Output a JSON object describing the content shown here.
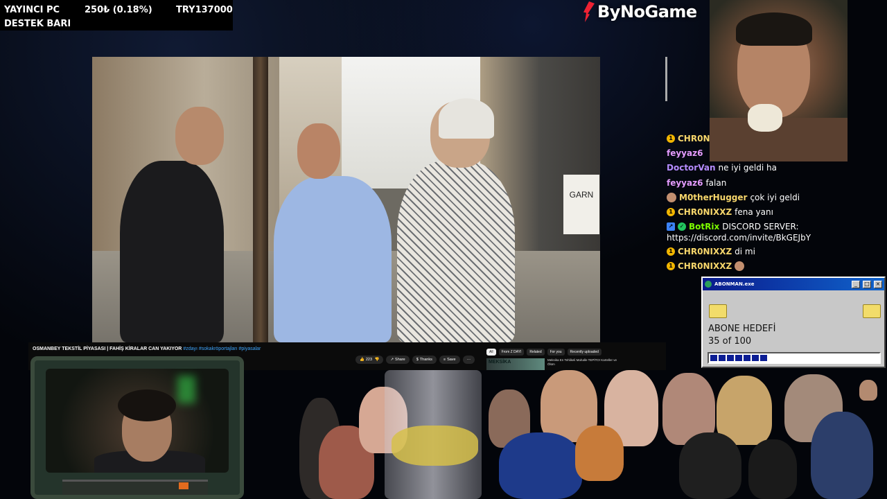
{
  "donation_bar": {
    "line1_left": "YAYINCI PC",
    "line1_mid": "250₺ (0.18%)",
    "line1_right": "TRY137000",
    "line2": "DESTEK BARI"
  },
  "logo": {
    "text": "ByNoGame"
  },
  "video": {
    "sign_text": "GARN"
  },
  "youtube": {
    "title": "OSMANBEY TEKSTİL PİYASASI | FAHİŞ KİRALAR CAN YAKIYOR",
    "hashtags": "#zdayı #sokakröportajları #piyasalar",
    "like_count": "223",
    "share_label": "Share",
    "thanks_label": "Thanks",
    "save_label": "Save",
    "more_label": "···",
    "chips": [
      "All",
      "From Z DAYI",
      "Related",
      "For you",
      "Recently uploaded"
    ],
    "rec_thumb_text": "MEKSİKA",
    "rec_title": "Meksika En Tehlikeli Mahalle TEPİTO! Karteller ve Ölüm"
  },
  "chat": {
    "messages": [
      {
        "user": "CHR0N",
        "text": ""
      },
      {
        "user": "feyyaz6",
        "text": ""
      },
      {
        "user": "DoctorVan",
        "text": "ne iyi geldi ha"
      },
      {
        "user": "feyyaz6",
        "text": "falan"
      },
      {
        "user": "M0therHugger",
        "text": "çok iyi geldi"
      },
      {
        "user": "CHR0NIXXZ",
        "text": "fena yanı"
      },
      {
        "user": "BotRix",
        "text": "DISCORD SERVER:"
      },
      {
        "user": "",
        "text": "https://discord.com/invite/BkGEJbY"
      },
      {
        "user": "CHR0NIXXZ",
        "text": "di mi"
      },
      {
        "user": "CHR0NIXXZ",
        "text": ""
      }
    ]
  },
  "sub_widget": {
    "window_title": "ABONMAN.exe",
    "goal_label": "ABONE HEDEFİ",
    "count_text": "35 of 100",
    "progress_fraction": 0.35,
    "btn_min": "_",
    "btn_max": "□",
    "btn_close": "×"
  },
  "colors": {
    "accent_red": "#e22233",
    "yt_link": "#3ea6ff",
    "win_title": "#0a1a8c",
    "progress_fill": "#0b1d94"
  }
}
